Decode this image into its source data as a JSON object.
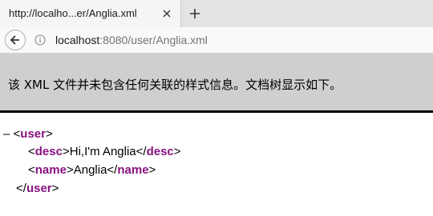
{
  "tab": {
    "title": "http://localho...er/Anglia.xml"
  },
  "address": {
    "host": "localhost",
    "rest": ":8080/user/Anglia.xml"
  },
  "banner": {
    "message": "该 XML 文件并未包含任何关联的样式信息。文档树显示如下。"
  },
  "xml": {
    "collapse_symbol": "–",
    "root": {
      "name": "user",
      "open": "<",
      "close_open": "</",
      "gt": ">"
    },
    "children": [
      {
        "name": "desc",
        "text": "Hi,I'm Anglia"
      },
      {
        "name": "name",
        "text": "Anglia"
      }
    ]
  },
  "colors": {
    "tag": "#881280",
    "banner": "#cfcfcf"
  }
}
